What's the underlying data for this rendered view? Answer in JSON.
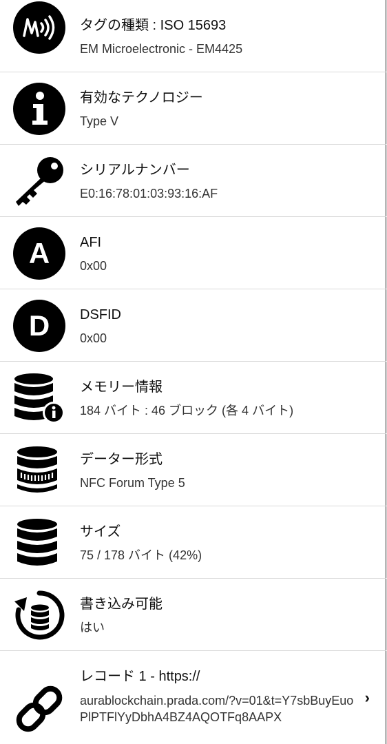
{
  "items": [
    {
      "title": "タグの種類 : ISO 15693",
      "value": "EM Microelectronic - EM4425",
      "icon": "nfc-tag-icon"
    },
    {
      "title": "有効なテクノロジー",
      "value": "Type V",
      "icon": "info-icon"
    },
    {
      "title": "シリアルナンバー",
      "value": "E0:16:78:01:03:93:16:AF",
      "icon": "key-icon"
    },
    {
      "title": "AFI",
      "value": "0x00",
      "icon": "letter-a-icon"
    },
    {
      "title": "DSFID",
      "value": "0x00",
      "icon": "letter-d-icon"
    },
    {
      "title": "メモリー情報",
      "value": "184 バイト : 46 ブロック (各 4 バイト)",
      "icon": "database-info-icon"
    },
    {
      "title": "データー形式",
      "value": "NFC Forum Type 5",
      "icon": "database-format-icon"
    },
    {
      "title": "サイズ",
      "value": "75 / 178 バイト (42%)",
      "icon": "database-icon"
    },
    {
      "title": "書き込み可能",
      "value": "はい",
      "icon": "writable-icon"
    },
    {
      "title": "レコード 1 - https://",
      "value": "aurablockchain.prada.com/?v=01&t=Y7sbBuyEuoPlPTFlYyDbhA4BZ4AQOTFq8AAPX",
      "icon": "link-icon"
    }
  ],
  "chevron": "›",
  "icon_color": "#000000"
}
